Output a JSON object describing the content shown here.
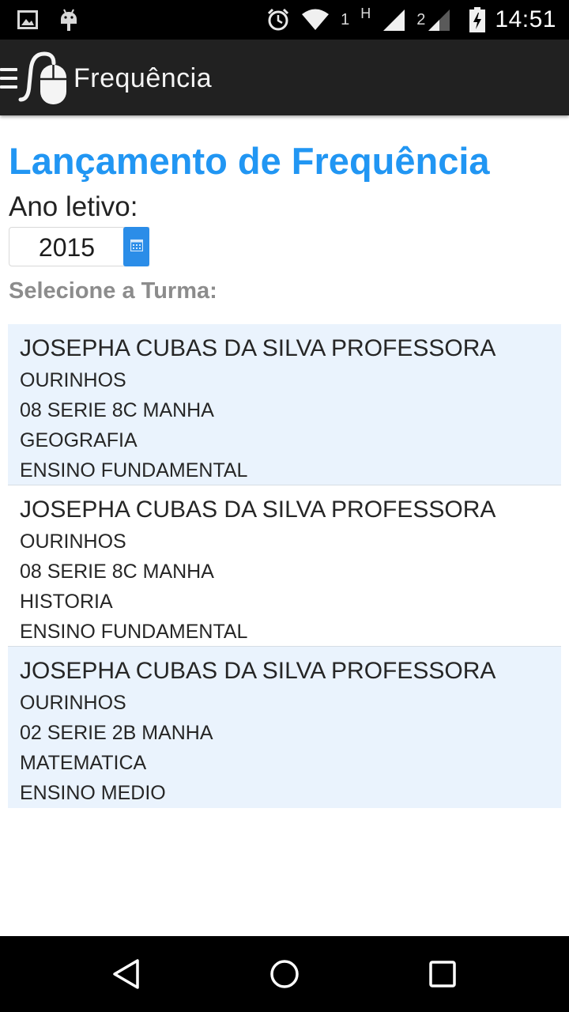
{
  "status_bar": {
    "time": "14:51",
    "sim1_label": "1",
    "network_type": "H",
    "sim2_label": "2",
    "icons": [
      "image-icon",
      "android-icon",
      "alarm-icon",
      "wifi-icon",
      "signal-icon",
      "battery-charging-icon"
    ]
  },
  "app_bar": {
    "title": "Frequência",
    "icons": [
      "menu-icon",
      "app-logo-mouse-icon"
    ]
  },
  "page": {
    "title": "Lançamento de Frequência",
    "year_label": "Ano letivo:",
    "year_value": "2015",
    "select_label": "Selecione a Turma:"
  },
  "classes": [
    {
      "teacher": "JOSEPHA CUBAS DA SILVA PROFESSORA",
      "city": "OURINHOS",
      "class": "08 SERIE 8C MANHA",
      "subject": "GEOGRAFIA",
      "level": "ENSINO FUNDAMENTAL"
    },
    {
      "teacher": "JOSEPHA CUBAS DA SILVA PROFESSORA",
      "city": "OURINHOS",
      "class": "08 SERIE 8C MANHA",
      "subject": "HISTORIA",
      "level": "ENSINO FUNDAMENTAL"
    },
    {
      "teacher": "JOSEPHA CUBAS DA SILVA PROFESSORA",
      "city": "OURINHOS",
      "class": "02 SERIE 2B MANHA",
      "subject": "MATEMATICA",
      "level": "ENSINO MEDIO"
    }
  ],
  "nav_bar": {
    "icons": [
      "back-icon",
      "home-icon",
      "recents-icon"
    ]
  },
  "colors": {
    "accent": "#2196F3",
    "app_bar": "#212121",
    "row_alt": "#EAF3FD",
    "muted_label": "#8C8C8C"
  }
}
